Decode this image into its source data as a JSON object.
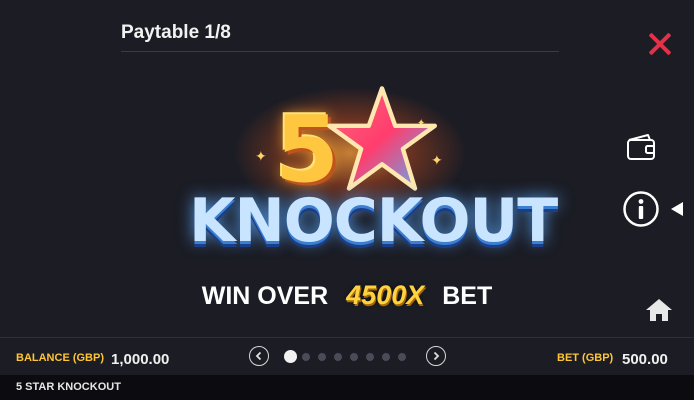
{
  "header": {
    "title": "Paytable 1/8"
  },
  "logo": {
    "five": "5",
    "word": "KNOCKOUT"
  },
  "win": {
    "prefix": "WIN OVER",
    "multiplier": "4500X",
    "suffix": "BET"
  },
  "pagination": {
    "current": 1,
    "total": 8
  },
  "balance": {
    "label": "BALANCE (GBP)",
    "value": "1,000.00"
  },
  "bet": {
    "label": "BET (GBP)",
    "value": "500.00"
  },
  "footer": {
    "game_name": "5 STAR KNOCKOUT"
  },
  "icons": {
    "close": "close-icon",
    "wallet": "wallet-icon",
    "info": "info-icon",
    "home": "home-icon",
    "prev": "chevron-left-icon",
    "next": "chevron-right-icon"
  },
  "colors": {
    "background": "#1b1c24",
    "close": "#e3314a",
    "label_gold": "#ffc534",
    "multiplier_gold": "#ffd23f",
    "footer_bg": "#0c0c10"
  }
}
